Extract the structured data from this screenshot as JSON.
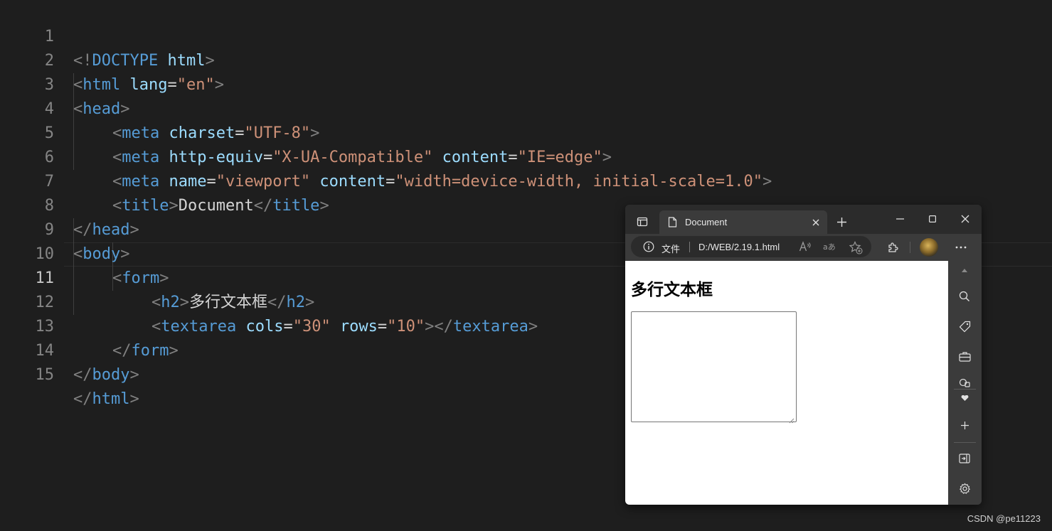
{
  "editor": {
    "active_line": "11",
    "lines": [
      {
        "n": "1"
      },
      {
        "n": "2"
      },
      {
        "n": "3"
      },
      {
        "n": "4"
      },
      {
        "n": "5"
      },
      {
        "n": "6"
      },
      {
        "n": "7"
      },
      {
        "n": "8"
      },
      {
        "n": "9"
      },
      {
        "n": "10"
      },
      {
        "n": "11"
      },
      {
        "n": "12"
      },
      {
        "n": "13"
      },
      {
        "n": "14"
      },
      {
        "n": "15"
      }
    ],
    "tokens": {
      "l1": [
        "<!",
        "DOCTYPE",
        " ",
        "html",
        ">"
      ],
      "l2": [
        "<",
        "html",
        " ",
        "lang",
        "=",
        "\"en\"",
        ">"
      ],
      "l3": [
        "<",
        "head",
        ">"
      ],
      "l4": [
        "<",
        "meta",
        " ",
        "charset",
        "=",
        "\"UTF-8\"",
        ">"
      ],
      "l5": [
        "<",
        "meta",
        " ",
        "http-equiv",
        "=",
        "\"X-UA-Compatible\"",
        " ",
        "content",
        "=",
        "\"IE=edge\"",
        ">"
      ],
      "l6": [
        "<",
        "meta",
        " ",
        "name",
        "=",
        "\"viewport\"",
        " ",
        "content",
        "=",
        "\"width=device-width, initial-scale=1.0\"",
        ">"
      ],
      "l7": [
        "<",
        "title",
        ">",
        "Document",
        "</",
        "title",
        ">"
      ],
      "l8": [
        "</",
        "head",
        ">"
      ],
      "l9": [
        "<",
        "body",
        ">"
      ],
      "l10": [
        "<",
        "form",
        ">"
      ],
      "l11": [
        "<",
        "h2",
        ">",
        "多行文本框",
        "</",
        "h2",
        ">"
      ],
      "l12": [
        "<",
        "textarea",
        " ",
        "cols",
        "=",
        "\"30\"",
        " ",
        "rows",
        "=",
        "\"10\"",
        "></",
        "textarea",
        ">"
      ],
      "l13": [
        "</",
        "form",
        ">"
      ],
      "l14": [
        "</",
        "body",
        ">"
      ],
      "l15": [
        "</",
        "html",
        ">"
      ]
    }
  },
  "browser": {
    "tab_title": "Document",
    "address_label": "文件",
    "url": "D:/WEB/2.19.1.html",
    "page_heading": "多行文本框",
    "icons": {
      "tab_actions": "tab-actions-icon",
      "page": "page-icon",
      "close_tab": "close-icon",
      "new_tab": "plus-icon",
      "minimize": "minimize-icon",
      "maximize": "maximize-icon",
      "close_window": "close-icon",
      "info": "info-icon",
      "read_aloud": "read-aloud-icon",
      "translate": "translate-icon",
      "favorite": "star-plus-icon",
      "extensions": "puzzle-icon",
      "profile": "avatar",
      "more": "more-icon",
      "sidebar": [
        "search-icon",
        "tag-icon",
        "toolbox-icon",
        "games-icon",
        "heart-icon",
        "plus-icon",
        "split-screen-icon",
        "gear-icon"
      ]
    },
    "colors": {
      "frame": "#2b2b2b",
      "toolbar": "#3b3b3b",
      "page": "#ffffff"
    }
  },
  "watermark": "CSDN @pe11223",
  "theme": {
    "tag": "#569cd6",
    "attr": "#9cdcfe",
    "string": "#ce9178",
    "punct": "#808080",
    "text": "#d4d4d4",
    "bg": "#1e1e1e"
  }
}
